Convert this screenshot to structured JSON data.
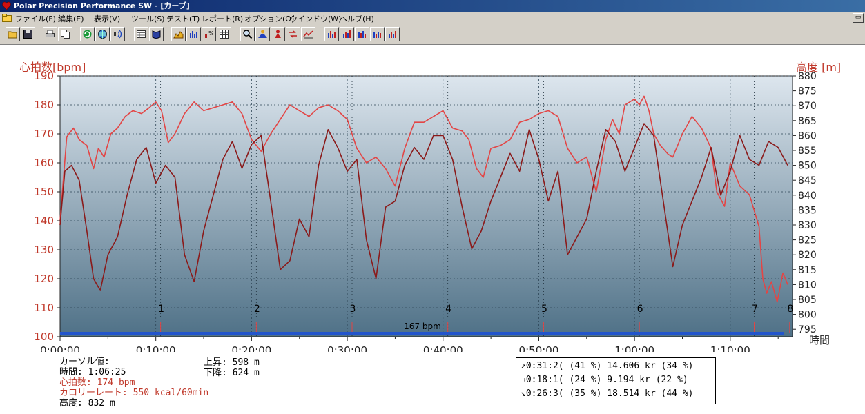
{
  "window": {
    "title": "Polar Precision Performance SW - [カーブ]"
  },
  "menu": {
    "items": [
      "ファイル(F)",
      "編集(E)",
      "表示(V)",
      "ツール(S)",
      "テスト(T)",
      "レポート(R)",
      "オプション(O)",
      "ウインドウ(W)",
      "ヘルプ(H)"
    ]
  },
  "toolbar": {
    "buttons": [
      {
        "name": "open-icon"
      },
      {
        "name": "save-icon"
      },
      {
        "name": "print-icon"
      },
      {
        "name": "copy-icon"
      },
      {
        "name": "refresh-icon"
      },
      {
        "name": "globe-icon"
      },
      {
        "name": "sound-icon"
      },
      {
        "name": "calendar-icon"
      },
      {
        "name": "book-icon"
      },
      {
        "name": "area-chart-icon"
      },
      {
        "name": "bar-chart-icon"
      },
      {
        "name": "percent-chart-icon"
      },
      {
        "name": "table-icon"
      },
      {
        "name": "zoom-icon"
      },
      {
        "name": "person-chart-icon"
      },
      {
        "name": "person-marker-icon"
      },
      {
        "name": "compare-icon"
      },
      {
        "name": "trend-icon"
      },
      {
        "name": "column-chart-1-icon"
      },
      {
        "name": "column-chart-2-icon"
      },
      {
        "name": "column-chart-3-icon"
      },
      {
        "name": "column-chart-4-icon"
      },
      {
        "name": "column-chart-5-icon"
      }
    ]
  },
  "colors": {
    "hr_line": "#e34545",
    "alt_line": "#8b1a1a",
    "axis_label": "#c0392b",
    "plot_top": "#dde6ee",
    "plot_bottom": "#4f7187",
    "grid": "#2d4455",
    "bottom_bar": "#2255cc"
  },
  "chart_data": {
    "type": "line",
    "y_left_label": "心拍数[bpm]",
    "y_right_label": "高度 [m]",
    "x_label": "時間",
    "y_left_ticks": [
      "100",
      "110",
      "120",
      "130",
      "140",
      "150",
      "160",
      "170",
      "180",
      "190"
    ],
    "y_right_ticks": [
      "795",
      "800",
      "805",
      "810",
      "815",
      "820",
      "825",
      "830",
      "835",
      "840",
      "845",
      "850",
      "855",
      "860",
      "865",
      "870",
      "875",
      "880"
    ],
    "x_ticks": [
      "0:00:00",
      "0:10:00",
      "0:20:00",
      "0:30:00",
      "0:40:00",
      "0:50:00",
      "1:00:00",
      "1:10:00"
    ],
    "ylim_left": [
      100,
      190
    ],
    "ylim_right": [
      792.5,
      880
    ],
    "xlim_minutes": [
      0,
      76.5
    ],
    "laps": [
      {
        "label": "1",
        "minute": 10.5
      },
      {
        "label": "2",
        "minute": 20.5
      },
      {
        "label": "3",
        "minute": 30.5
      },
      {
        "label": "4",
        "minute": 40.5
      },
      {
        "label": "5",
        "minute": 50.5
      },
      {
        "label": "6",
        "minute": 60.5
      },
      {
        "label": "7",
        "minute": 72.5
      },
      {
        "label": "8",
        "minute": 76.2
      }
    ],
    "marker_label": "167 bpm",
    "series": [
      {
        "name": "心拍数",
        "axis": "left",
        "x_minutes": [
          0,
          0.7,
          1.4,
          2,
          2.8,
          3.5,
          4,
          4.6,
          5.3,
          6,
          6.8,
          7.6,
          8.5,
          9.3,
          10,
          10.6,
          11.3,
          12,
          13,
          14,
          15,
          16,
          17,
          18,
          19,
          20,
          21,
          22,
          23,
          24,
          25,
          26,
          27,
          28,
          29,
          30,
          31,
          32,
          33,
          34,
          35,
          36,
          37,
          38,
          39,
          40,
          41,
          42,
          42.7,
          43.5,
          44.2,
          45,
          46,
          47,
          48,
          49,
          50,
          51,
          52,
          53,
          54,
          55,
          56,
          57,
          57.7,
          58.4,
          59,
          60,
          60.5,
          61,
          61.5,
          62,
          62.7,
          63.5,
          64,
          65,
          66,
          67,
          68,
          68.6,
          69.4,
          70,
          71,
          72,
          73,
          73.4,
          73.8,
          74.3,
          74.9,
          75.5,
          76
        ],
        "values": [
          140,
          169,
          172,
          168,
          166,
          158,
          165,
          162,
          170,
          172,
          176,
          178,
          177,
          179,
          181,
          178,
          167,
          170,
          177,
          181,
          178,
          179,
          180,
          181,
          177,
          168,
          164,
          170,
          175,
          180,
          178,
          176,
          179,
          180,
          178,
          175,
          165,
          160,
          162,
          158,
          152,
          165,
          174,
          174,
          176,
          178,
          172,
          171,
          168,
          158,
          155,
          165,
          166,
          168,
          174,
          175,
          177,
          178,
          176,
          165,
          160,
          162,
          150,
          168,
          175,
          170,
          180,
          182,
          180,
          183,
          178,
          170,
          166,
          163,
          162,
          170,
          176,
          172,
          165,
          150,
          145,
          160,
          152,
          149,
          138,
          120,
          115,
          119,
          112,
          122,
          118
        ]
      },
      {
        "name": "高度",
        "axis": "right",
        "x_minutes": [
          0,
          0.5,
          1.2,
          2,
          2.8,
          3.5,
          4.2,
          5,
          6,
          7,
          8,
          9,
          10,
          11,
          12,
          13,
          14,
          15,
          16,
          17,
          18,
          19,
          20,
          21,
          22,
          23,
          24,
          25,
          26,
          27,
          28,
          29,
          30,
          31,
          32,
          33,
          34,
          35,
          36,
          37,
          38,
          39,
          40,
          41,
          42,
          43,
          44,
          45,
          46,
          47,
          48,
          49,
          50,
          51,
          52,
          53,
          54,
          55,
          56,
          57,
          58,
          59,
          60,
          61,
          62,
          63,
          64,
          65,
          66,
          67,
          68,
          69,
          70,
          71,
          72,
          73,
          74,
          75,
          76
        ],
        "values": [
          830,
          848,
          850,
          845,
          828,
          812,
          808,
          820,
          826,
          840,
          852,
          856,
          844,
          850,
          846,
          820,
          811,
          828,
          840,
          852,
          858,
          849,
          857,
          860,
          838,
          815,
          818,
          832,
          826,
          850,
          862,
          856,
          848,
          852,
          825,
          812,
          836,
          838,
          850,
          856,
          852,
          860,
          860,
          852,
          836,
          822,
          828,
          838,
          846,
          854,
          848,
          862,
          852,
          838,
          848,
          820,
          826,
          832,
          848,
          862,
          858,
          848,
          856,
          864,
          860,
          838,
          816,
          830,
          838,
          846,
          856,
          840,
          848,
          860,
          852,
          850,
          858,
          856,
          850
        ]
      }
    ]
  },
  "curve_values": {
    "header": "カーソル値:",
    "time": "時間: 1:06:25",
    "hr": "心拍数: 174 bpm",
    "calorie": "カロリーレート: 550 kcal/60min",
    "altitude": "高度: 832 m"
  },
  "elevation": {
    "ascent": "上昇: 598 m",
    "descent": "下降: 624 m"
  },
  "stats": [
    {
      "arrow": "↗",
      "time": "0:31:2(",
      "pct1": "(41 %)",
      "dist": "14.606 kr",
      "pct2": "(34 %)"
    },
    {
      "arrow": "→",
      "time": "0:18:1(",
      "pct1": "(24 %)",
      "dist": " 9.194 kr",
      "pct2": "(22 %)"
    },
    {
      "arrow": "↘",
      "time": "0:26:3(",
      "pct1": "(35 %)",
      "dist": "18.514 kr",
      "pct2": "(44 %)"
    }
  ]
}
